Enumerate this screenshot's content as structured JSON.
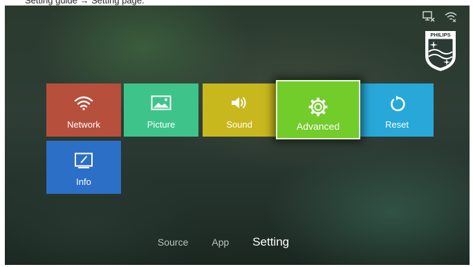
{
  "caption": "Setting guide → Setting page.",
  "status": {
    "icons": [
      "display-x-icon",
      "wifi-off-icon"
    ]
  },
  "brand": {
    "logo_text": "PHILIPS"
  },
  "tiles": [
    {
      "label": "Network",
      "icon": "wifi-icon",
      "color": "#b6503c"
    },
    {
      "label": "Picture",
      "icon": "picture-icon",
      "color": "#3ec48a"
    },
    {
      "label": "Sound",
      "icon": "speaker-icon",
      "color": "#c8b81e"
    },
    {
      "label": "Advanced",
      "icon": "gear-icon",
      "color": "#72cc2a",
      "selected": true
    },
    {
      "label": "Reset",
      "icon": "reset-icon",
      "color": "#27a8d8"
    },
    {
      "label": "Info",
      "icon": "info-screen-icon",
      "color": "#2c6fc6"
    }
  ],
  "bottom_nav": [
    {
      "label": "Source"
    },
    {
      "label": "App"
    },
    {
      "label": "Setting",
      "active": true
    }
  ]
}
